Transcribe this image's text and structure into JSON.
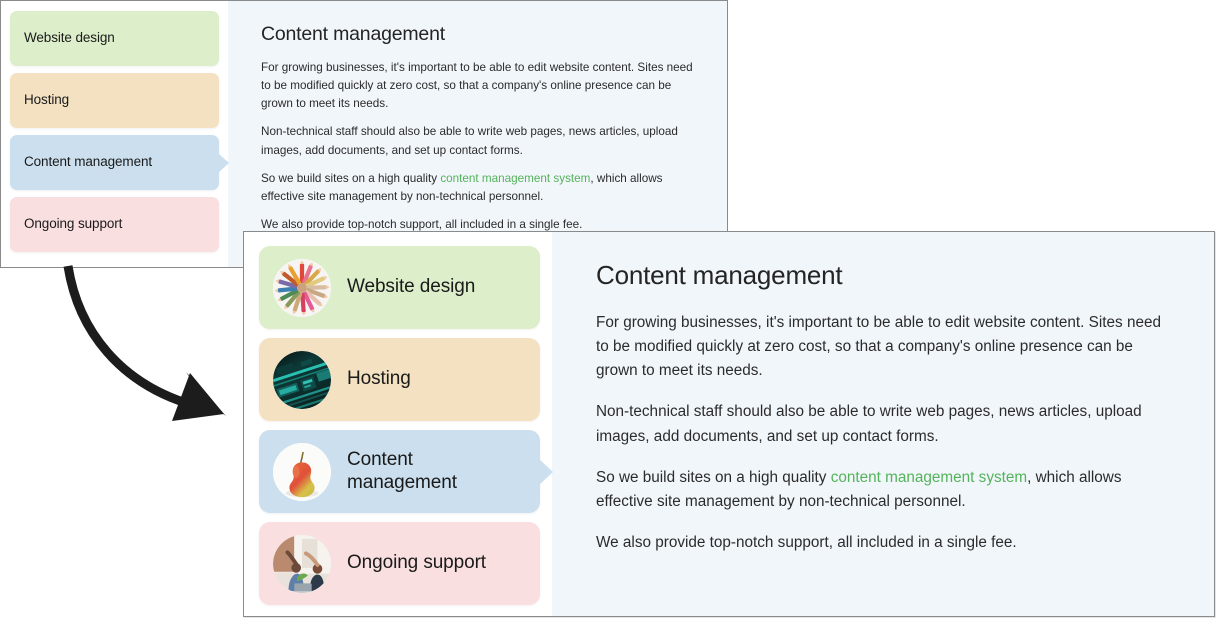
{
  "services": [
    {
      "id": "website-design",
      "label": "Website design",
      "color": "#ddeecb",
      "thumb": "colored-pencils-thumbnail",
      "selected": false
    },
    {
      "id": "hosting",
      "label": "Hosting",
      "color": "#f3e1c2",
      "thumb": "circuit-board-thumbnail",
      "selected": false
    },
    {
      "id": "content-management",
      "label": "Content management",
      "label_wrapped_line1": "Content",
      "label_wrapped_line2": "management",
      "color": "#cbdfee",
      "thumb": "pear-thumbnail",
      "selected": true
    },
    {
      "id": "ongoing-support",
      "label": "Ongoing support",
      "color": "#fadfe0",
      "thumb": "office-team-thumbnail",
      "selected": false
    }
  ],
  "article": {
    "title": "Content management",
    "paragraph1": "For growing businesses, it's important to be able to edit website content. Sites need to be modified quickly at zero cost, so that a company's online presence can be grown to meet its needs.",
    "paragraph2": "Non-technical staff should also be able to write web pages, news articles, upload images, add documents, and set up contact forms.",
    "paragraph3_before": "So we build sites on a high quality ",
    "paragraph3_link": "content management system",
    "paragraph3_after": ", which allows effective site management by non-technical personnel.",
    "paragraph4": "We also provide top-notch support, all included in a single fee."
  },
  "colors": {
    "content_background": "#f1f6fb",
    "link_green": "#54b35a",
    "panel_border": "#8a8a8a",
    "arrow": "#1c1c1c"
  },
  "annotation": {
    "arrow": "curved-down-right-arrow"
  }
}
